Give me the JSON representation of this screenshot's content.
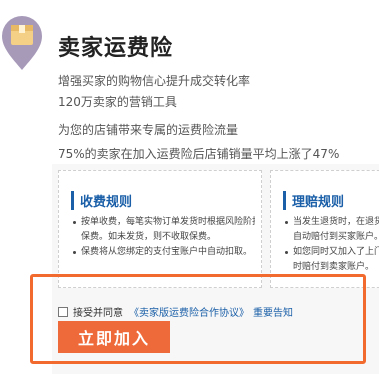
{
  "header": {
    "title": "卖家运费险"
  },
  "intro": {
    "line1": "增强买家的购物信心提升成交转化率",
    "line2": "120万卖家的营销工具",
    "line3": "为您的店铺带来专属的运费险流量",
    "line4": "75%的卖家在加入运费险后店铺销量平均上涨了47%"
  },
  "rules": {
    "fee": {
      "title": "收费规则",
      "items": [
        {
          "text": "按单收费，每笔实物订单发货时根据风险阶扣取",
          "bullet": true
        },
        {
          "text": "保费。如未发货，则不收取保费。",
          "bullet": false
        },
        {
          "text": "保费将从您绑定的支付宝账户中自动扣取。",
          "bullet": true
        }
      ]
    },
    "claim": {
      "title": "理赔规则",
      "items": [
        {
          "text": "当发生退货时，在退货退",
          "bullet": true
        },
        {
          "text": "自动赔付到买家账户。",
          "bullet": false
        },
        {
          "text": "如您同时又加入了上门退",
          "bullet": true
        },
        {
          "text": "时赔付到卖家账户。",
          "bullet": false
        }
      ]
    }
  },
  "agreement": {
    "text": "接受并同意",
    "link": "《卖家版运费险合作协议》",
    "notice": "重要告知"
  },
  "join_button": {
    "label": "立即加入"
  },
  "colors": {
    "accent": "#ef6a3a",
    "highlight_border": "#f26a2e",
    "link": "#1a5fa8",
    "pin": "#a79ab9",
    "box": "#f4cf86"
  }
}
